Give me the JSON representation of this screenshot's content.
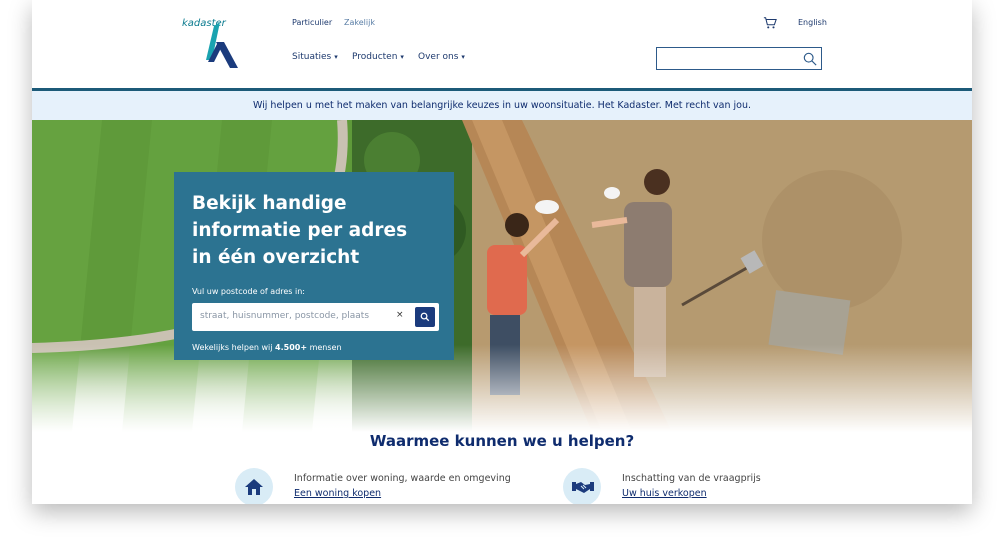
{
  "logo": {
    "text": "kadaster"
  },
  "audience": {
    "particulier": "Particulier",
    "zakelijk": "Zakelijk"
  },
  "nav": [
    "Situaties",
    "Producten",
    "Over ons"
  ],
  "lang": "English",
  "search": {
    "placeholder": ""
  },
  "banner": "Wij helpen u met het maken van belangrijke keuzes in uw woonsituatie. Het Kadaster. Met recht van jou.",
  "hero": {
    "title": "Bekijk handige informatie per adres in één overzicht",
    "input_label": "Vul uw postcode of adres in:",
    "input_placeholder": "straat, huisnummer, postcode, plaats",
    "clear": "×",
    "count_prefix": "Wekelijks helpen wij ",
    "count_value": "4.500+",
    "count_suffix": " mensen"
  },
  "help": {
    "title": "Waarmee kunnen we u helpen?",
    "items": [
      {
        "desc": "Informatie over woning, waarde en omgeving",
        "link": "Een woning kopen",
        "icon": "house-icon"
      },
      {
        "desc": "Inschatting van de vraagprijs",
        "link": "Uw huis verkopen",
        "icon": "handshake-icon"
      }
    ]
  },
  "colors": {
    "brand_navy": "#0f2c6e",
    "teal": "#2c7391",
    "banner_bg": "#e6f1fb"
  }
}
